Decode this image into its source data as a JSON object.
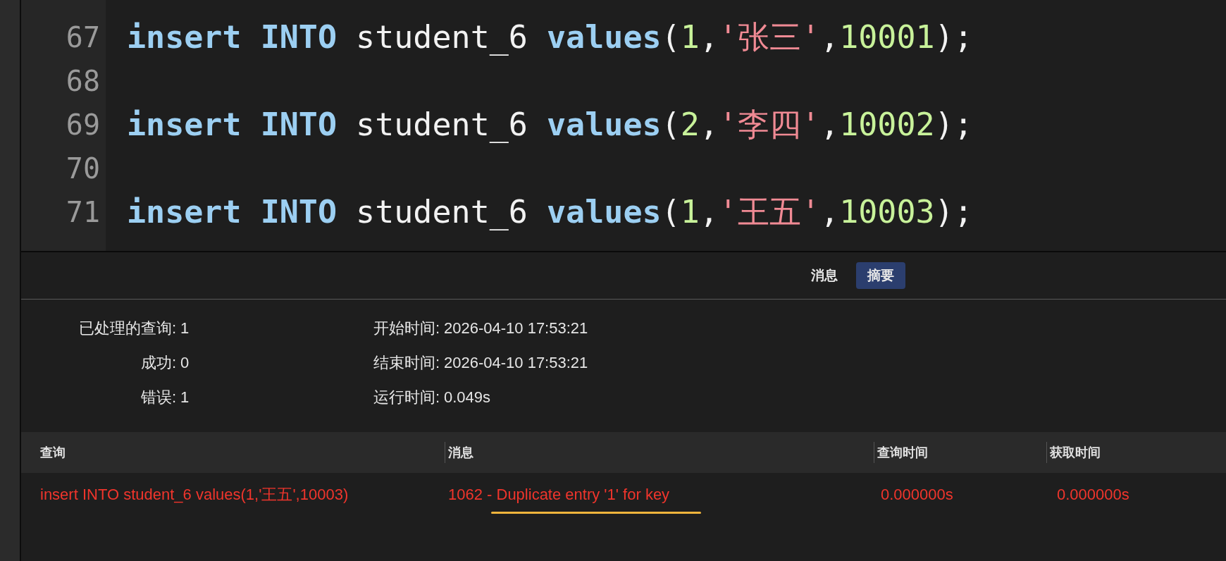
{
  "editor": {
    "lines": [
      {
        "number": "67",
        "tokens": [
          {
            "kind": "keyword",
            "text": "insert",
            "spaced": true
          },
          {
            "kind": "keyword",
            "text": "INTO",
            "spaced": true
          },
          {
            "kind": "plain",
            "text": "student_6",
            "spaced": true
          },
          {
            "kind": "keyword",
            "text": "values"
          },
          {
            "kind": "plain",
            "text": "("
          },
          {
            "kind": "number",
            "text": "1"
          },
          {
            "kind": "plain",
            "text": ","
          },
          {
            "kind": "string",
            "text": "'张三'"
          },
          {
            "kind": "plain",
            "text": ","
          },
          {
            "kind": "number",
            "text": "10001"
          },
          {
            "kind": "plain",
            "text": ");"
          }
        ]
      },
      {
        "number": "68"
      },
      {
        "number": "69",
        "tokens": [
          {
            "kind": "keyword",
            "text": "insert",
            "spaced": true
          },
          {
            "kind": "keyword",
            "text": "INTO",
            "spaced": true
          },
          {
            "kind": "plain",
            "text": "student_6",
            "spaced": true
          },
          {
            "kind": "keyword",
            "text": "values"
          },
          {
            "kind": "plain",
            "text": "("
          },
          {
            "kind": "number",
            "text": "2"
          },
          {
            "kind": "plain",
            "text": ","
          },
          {
            "kind": "string",
            "text": "'李四'"
          },
          {
            "kind": "plain",
            "text": ","
          },
          {
            "kind": "number",
            "text": "10002"
          },
          {
            "kind": "plain",
            "text": ");"
          }
        ]
      },
      {
        "number": "70"
      },
      {
        "number": "71",
        "tokens": [
          {
            "kind": "keyword",
            "text": "insert",
            "spaced": true
          },
          {
            "kind": "keyword",
            "text": "INTO",
            "spaced": true
          },
          {
            "kind": "plain",
            "text": "student_6",
            "spaced": true
          },
          {
            "kind": "keyword",
            "text": "values"
          },
          {
            "kind": "plain",
            "text": "("
          },
          {
            "kind": "number",
            "text": "1"
          },
          {
            "kind": "plain",
            "text": ","
          },
          {
            "kind": "string",
            "text": "'王五'"
          },
          {
            "kind": "plain",
            "text": ","
          },
          {
            "kind": "number",
            "text": "10003"
          },
          {
            "kind": "plain",
            "text": ");"
          }
        ]
      }
    ]
  },
  "tabs": [
    {
      "label": "消息",
      "selected": false
    },
    {
      "label": "摘要",
      "selected": true
    }
  ],
  "summary": {
    "left": [
      {
        "label": "已处理的查询:",
        "value": "1"
      },
      {
        "label": "成功:",
        "value": "0"
      },
      {
        "label": "错误:",
        "value": "1"
      }
    ],
    "right": [
      {
        "label": "开始时间:",
        "value": "2026-04-10 17:53:21"
      },
      {
        "label": "结束时间:",
        "value": "2026-04-10 17:53:21"
      },
      {
        "label": "运行时间:",
        "value": "0.049s"
      }
    ]
  },
  "table": {
    "columns": [
      "查询",
      "消息",
      "查询时间",
      "获取时间"
    ],
    "rows": [
      {
        "error": true,
        "cells": [
          "insert INTO student_6 values(1,'王五',10003)",
          "1062 - Duplicate entry '1' for key",
          "0.000000s",
          "0.000000s"
        ]
      }
    ]
  }
}
